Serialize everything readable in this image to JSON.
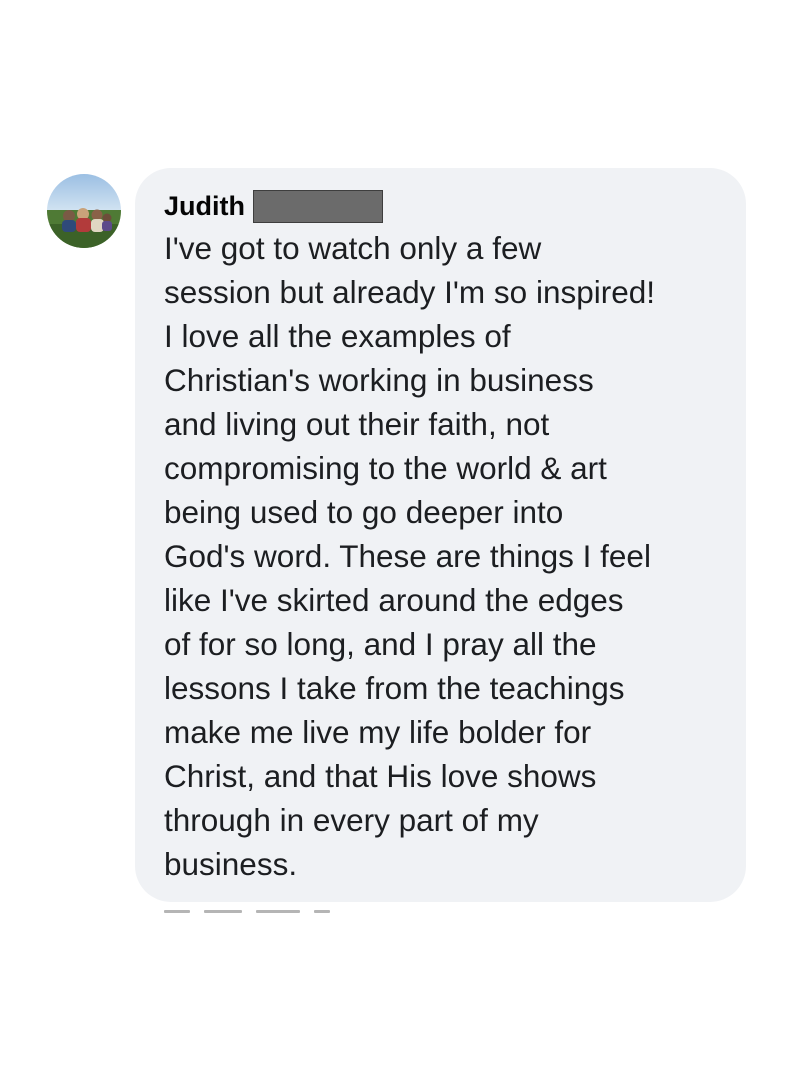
{
  "comment": {
    "author": {
      "first_name": "Judith",
      "last_name_redacted": true
    },
    "text_lines": [
      "I've got to watch only a few",
      "session but already I'm so inspired!",
      "I love all the examples of",
      "Christian's working in business",
      "and living out their faith, not",
      "compromising to the world & art",
      "being used to go deeper into",
      "God's word. These are things I feel",
      "like I've skirted around the edges",
      "of for so long, and I pray all the",
      "lessons I take from the teachings",
      "make me live my life bolder for",
      "Christ, and that His love shows",
      "through in every part of my",
      "business."
    ]
  },
  "colors": {
    "bubble_background": "#f0f2f5",
    "text": "#1c1e21",
    "author_text": "#050505",
    "redaction": "#6b6b6b"
  }
}
